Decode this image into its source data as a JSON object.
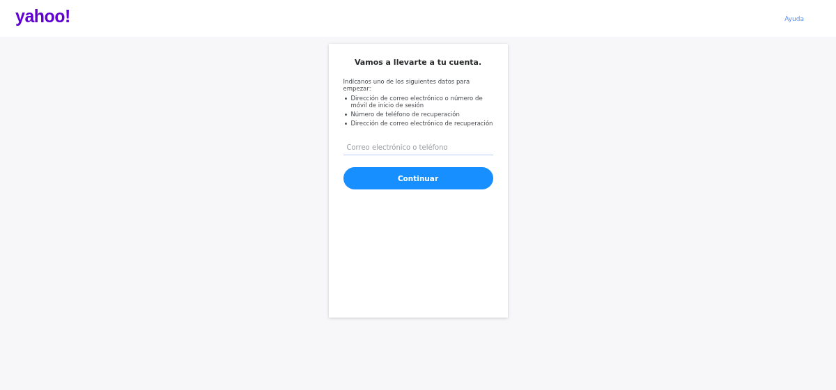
{
  "header": {
    "logo": "yahoo!",
    "help_link": "Ayuda"
  },
  "card": {
    "title": "Vamos a llevarte a tu cuenta.",
    "intro": "Indícanos uno de los siguientes datos para empezar:",
    "options": [
      "Dirección de correo electrónico o número de móvil de inicio de sesión",
      "Número de teléfono de recuperación",
      "Dirección de correo electrónico de recuperación"
    ],
    "field": {
      "placeholder": "Correo electrónico o teléfono"
    },
    "button": "Continuar"
  }
}
